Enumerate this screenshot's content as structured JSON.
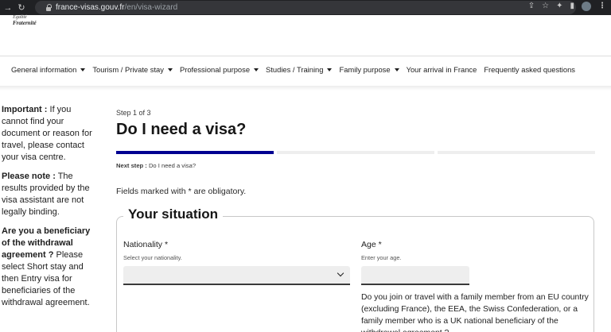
{
  "browser": {
    "url_domain": "france-visas.gouv.fr",
    "url_path": "/en/visa-wizard"
  },
  "header": {
    "logo_line1": "Egalité",
    "logo_line2": "Fraternité"
  },
  "nav": {
    "items": [
      {
        "label": "General information",
        "has_dropdown": true
      },
      {
        "label": "Tourism / Private stay",
        "has_dropdown": true
      },
      {
        "label": "Professional purpose",
        "has_dropdown": true
      },
      {
        "label": "Studies / Training",
        "has_dropdown": true
      },
      {
        "label": "Family purpose",
        "has_dropdown": true
      },
      {
        "label": "Your arrival in France",
        "has_dropdown": false
      },
      {
        "label": "Frequently asked questions",
        "has_dropdown": false
      }
    ]
  },
  "sidebar": {
    "important_label": "Important :",
    "important_text": " If you cannot find your document or reason for travel, please contact your visa centre.",
    "note_label": "Please note :",
    "note_text": " The results provided by the visa assistant are not legally binding.",
    "withdrawal_label": "Are you a beneficiary of the withdrawal agreement ?",
    "withdrawal_text": " Please select Short stay and then Entry visa for beneficiaries of the withdrawal agreement."
  },
  "main": {
    "step_label": "Step 1 of 3",
    "title": "Do I need a visa?",
    "next_step_label": "Next step :",
    "next_step_value": " Do I need a visa?",
    "obligatory_text": "Fields marked with * are obligatory.",
    "progress": {
      "current_step": 1,
      "total_steps": 3
    },
    "fieldset_legend": "Your situation",
    "nationality": {
      "label": "Nationality *",
      "hint": "Select your nationality.",
      "value": ""
    },
    "age": {
      "label": "Age *",
      "hint": "Enter your age.",
      "value": ""
    },
    "family_question": "Do you join or travel with a family member from an EU country (excluding France), the EEA, the Swiss Confederation, or a family member who is a UK national beneficiary of the withdrawal agreement ?"
  },
  "colors": {
    "accent": "#000091",
    "field_bg": "#eeeeee"
  }
}
